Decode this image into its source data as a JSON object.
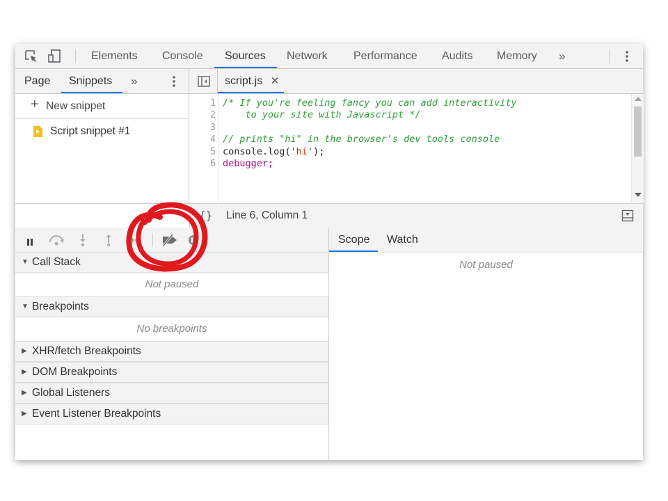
{
  "toolbar": {
    "tabs": [
      {
        "label": "Elements"
      },
      {
        "label": "Console"
      },
      {
        "label": "Sources"
      },
      {
        "label": "Network"
      },
      {
        "label": "Performance"
      },
      {
        "label": "Audits"
      },
      {
        "label": "Memory"
      }
    ],
    "active_tab": "Sources"
  },
  "navigator": {
    "tabs": [
      {
        "label": "Page"
      },
      {
        "label": "Snippets"
      }
    ],
    "active_tab": "Snippets",
    "new_snippet_label": "New snippet",
    "snippets": [
      {
        "label": "Script snippet #1"
      }
    ]
  },
  "editor": {
    "file_tab": "script.js",
    "line_numbers": [
      "1",
      "2",
      "3",
      "4",
      "5",
      "6"
    ],
    "lines": [
      {
        "text": "/* If you're feeling fancy you can add interactivity"
      },
      {
        "text": "    to your site with Javascript */"
      },
      {
        "text": ""
      },
      {
        "text": "// prints \"hi\" in the browser's dev tools console"
      },
      {
        "parts": [
          "console.log(",
          "'hi'",
          ");"
        ]
      },
      {
        "text": "debugger;"
      }
    ],
    "status": "Line 6, Column 1"
  },
  "debugger": {
    "sections": {
      "call_stack": {
        "title": "Call Stack",
        "empty": "Not paused"
      },
      "breakpoints": {
        "title": "Breakpoints",
        "empty": "No breakpoints"
      },
      "xhr": {
        "title": "XHR/fetch Breakpoints"
      },
      "dom": {
        "title": "DOM Breakpoints"
      },
      "global": {
        "title": "Global Listeners"
      },
      "event": {
        "title": "Event Listener Breakpoints"
      }
    },
    "side_tabs": [
      {
        "label": "Scope"
      },
      {
        "label": "Watch"
      }
    ],
    "side_active": "Scope",
    "scope_empty": "Not paused"
  },
  "colors": {
    "accent": "#1a73e8",
    "annotation": "#e0191f",
    "snippet_icon": "#f2c01e"
  }
}
